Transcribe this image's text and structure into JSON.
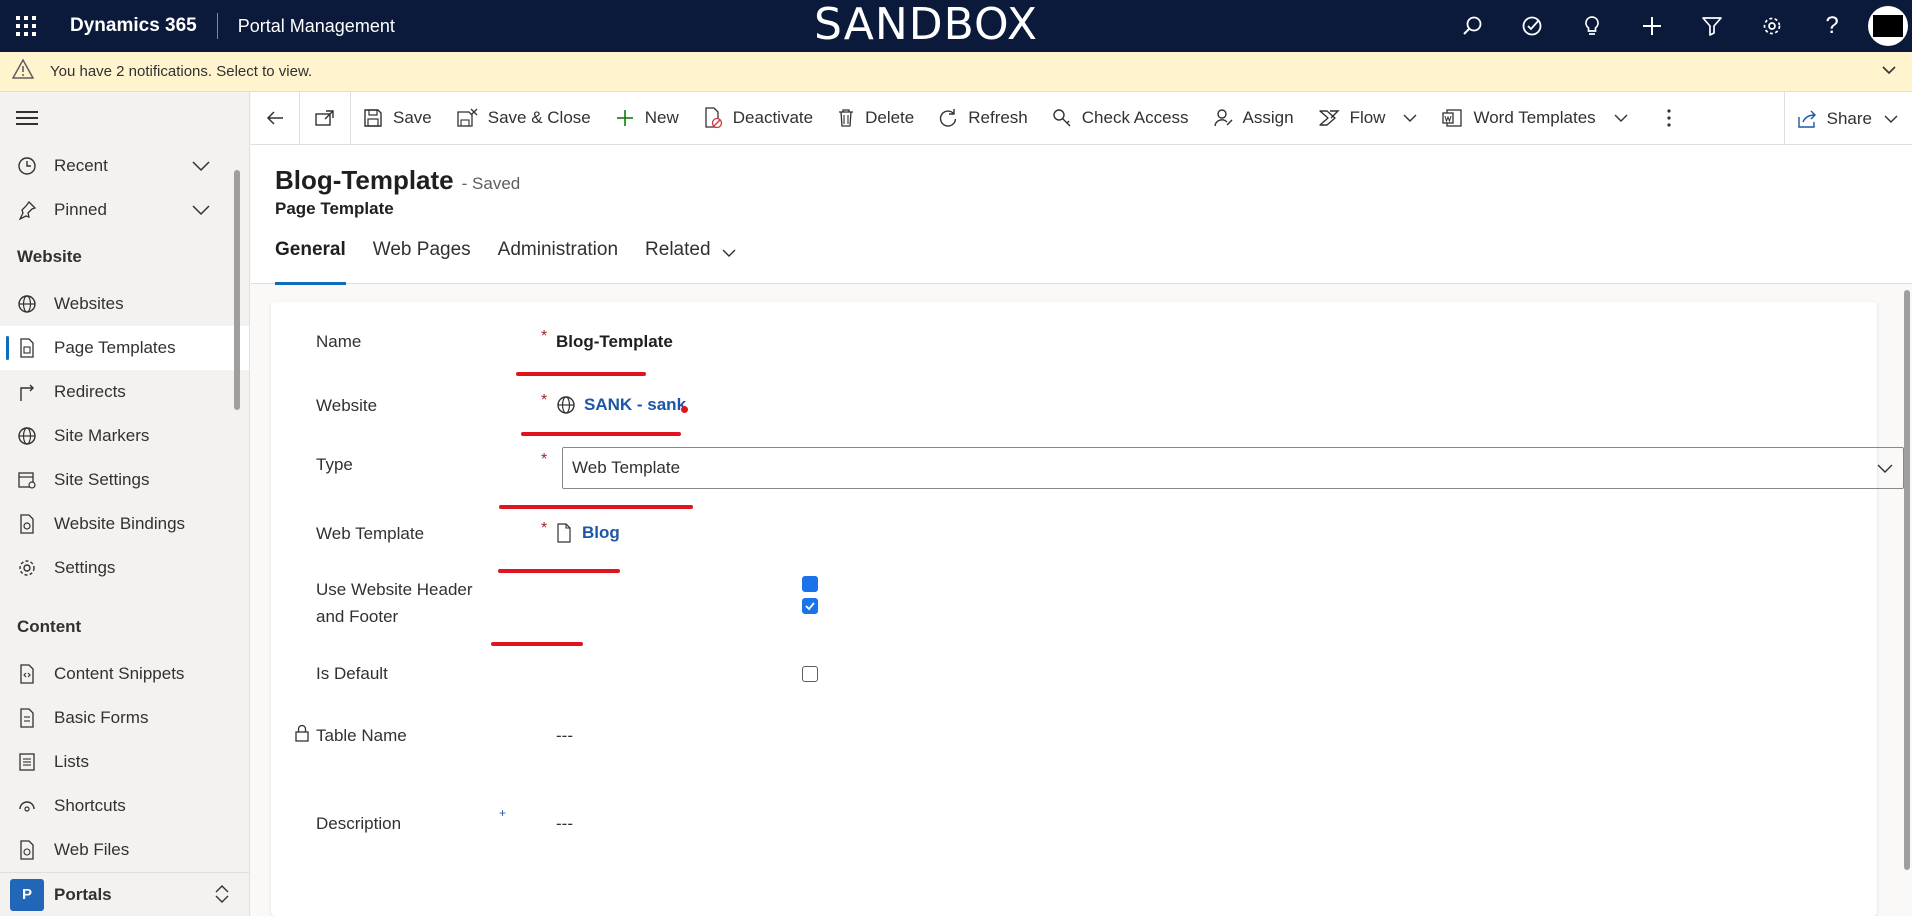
{
  "topbar": {
    "product": "Dynamics 365",
    "app": "Portal Management",
    "environment": "SANDBOX",
    "icons": [
      "search-icon",
      "task-icon",
      "lightbulb-icon",
      "plus-icon",
      "filter-icon",
      "gear-icon",
      "help-icon",
      "avatar"
    ]
  },
  "notification": {
    "text": "You have 2 notifications. Select to view."
  },
  "sidebar": {
    "recent": "Recent",
    "pinned": "Pinned",
    "sections": [
      {
        "title": "Website",
        "items": [
          {
            "label": "Websites",
            "icon": "globe-icon"
          },
          {
            "label": "Page Templates",
            "icon": "page-icon",
            "active": true
          },
          {
            "label": "Redirects",
            "icon": "redirect-icon"
          },
          {
            "label": "Site Markers",
            "icon": "globe-icon"
          },
          {
            "label": "Site Settings",
            "icon": "settings-page-icon"
          },
          {
            "label": "Website Bindings",
            "icon": "binding-icon"
          },
          {
            "label": "Settings",
            "icon": "gear-icon"
          }
        ]
      },
      {
        "title": "Content",
        "items": [
          {
            "label": "Content Snippets",
            "icon": "snippet-icon"
          },
          {
            "label": "Basic Forms",
            "icon": "form-icon"
          },
          {
            "label": "Lists",
            "icon": "list-icon"
          },
          {
            "label": "Shortcuts",
            "icon": "shortcut-icon"
          },
          {
            "label": "Web Files",
            "icon": "file-icon"
          }
        ]
      }
    ],
    "area": {
      "badge": "P",
      "label": "Portals"
    }
  },
  "commands": {
    "save": "Save",
    "save_close": "Save & Close",
    "new": "New",
    "deactivate": "Deactivate",
    "delete": "Delete",
    "refresh": "Refresh",
    "check_access": "Check Access",
    "assign": "Assign",
    "flow": "Flow",
    "word_templates": "Word Templates",
    "share": "Share"
  },
  "record": {
    "title": "Blog-Template",
    "status": "- Saved",
    "entity": "Page Template",
    "tabs": [
      "General",
      "Web Pages",
      "Administration",
      "Related"
    ]
  },
  "form": {
    "name_label": "Name",
    "name_value": "Blog-Template",
    "website_label": "Website",
    "website_value": "SANK - sank",
    "type_label": "Type",
    "type_value": "Web Template",
    "webtemplate_label": "Web Template",
    "webtemplate_value": "Blog",
    "use_header_label_1": "Use Website Header",
    "use_header_label_2": "and Footer",
    "use_header_checked": true,
    "is_default_label": "Is Default",
    "is_default_checked": false,
    "table_name_label": "Table Name",
    "table_name_value": "---",
    "description_label": "Description",
    "description_value": "---"
  },
  "colors": {
    "topbar": "#0b1a3a",
    "notification": "#fff4ce",
    "accent": "#0f6cbd",
    "link": "#1c57a7",
    "annotation": "#e0141e"
  }
}
